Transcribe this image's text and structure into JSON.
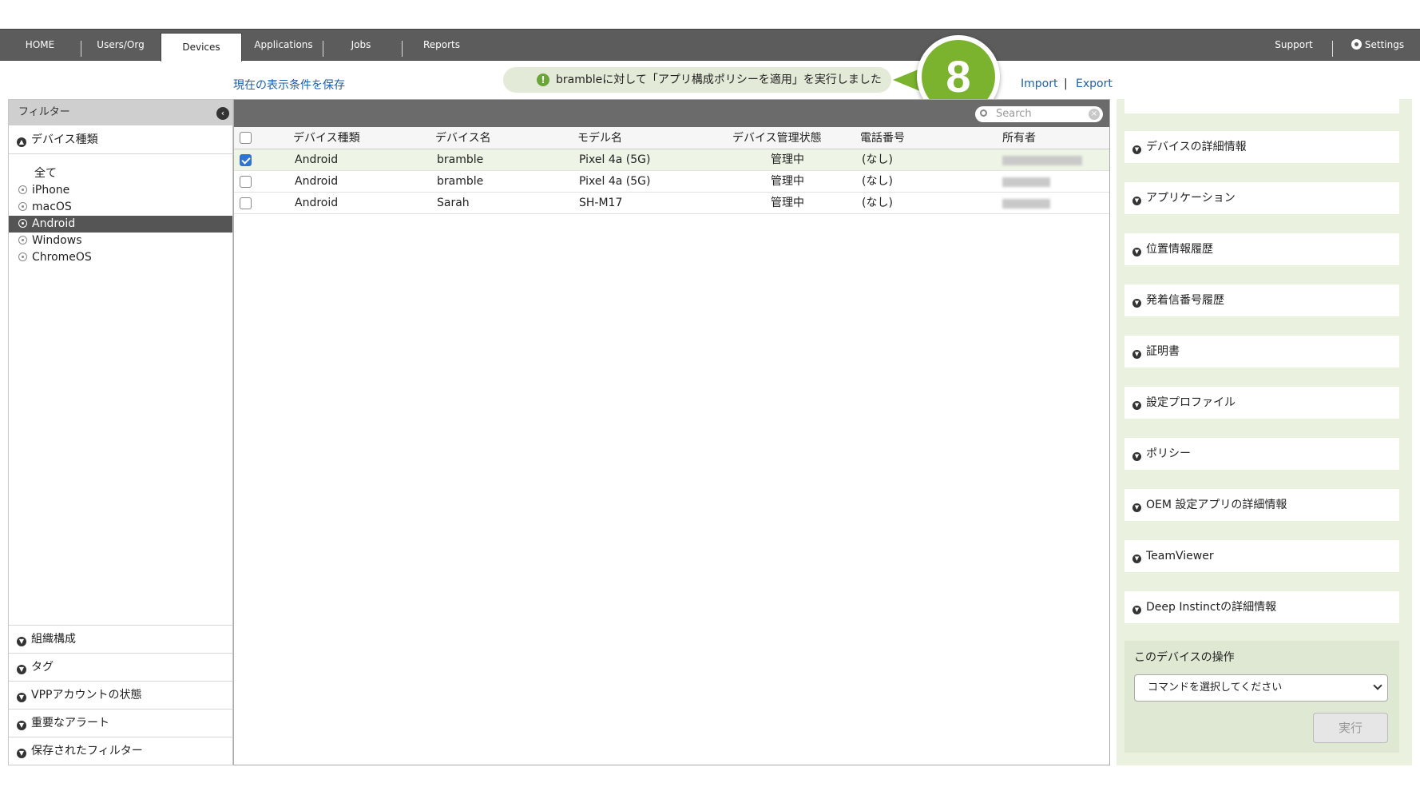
{
  "nav": {
    "tabs": [
      "HOME",
      "Users/Org",
      "Devices",
      "Applications",
      "Jobs",
      "Reports"
    ],
    "active_tab": "Devices",
    "support": "Support",
    "settings": "Settings"
  },
  "links": {
    "save_view": "現在の表示条件を保存",
    "import": "Import",
    "separator": "|",
    "export": "Export"
  },
  "toast": {
    "message": "brambleに対して「アプリ構成ポリシーを適用」を実行しました"
  },
  "step_badge": "8",
  "left": {
    "filter_title": "フィルター",
    "device_type_section": "デバイス種類",
    "all_label": "全て",
    "options": [
      "iPhone",
      "macOS",
      "Android",
      "Windows",
      "ChromeOS"
    ],
    "selected_option": "Android",
    "bottom_sections": [
      "組織構成",
      "タグ",
      "VPPアカウントの状態",
      "重要なアラート",
      "保存されたフィルター"
    ]
  },
  "table": {
    "search_placeholder": "Search",
    "columns": [
      "デバイス種類",
      "デバイス名",
      "モデル名",
      "デバイス管理状態",
      "電話番号",
      "所有者"
    ],
    "rows": [
      {
        "checked": true,
        "type": "Android",
        "name": "bramble",
        "model": "Pixel 4a (5G)",
        "status": "管理中",
        "phone": "(なし)"
      },
      {
        "checked": false,
        "type": "Android",
        "name": "bramble",
        "model": "Pixel 4a (5G)",
        "status": "管理中",
        "phone": "(なし)"
      },
      {
        "checked": false,
        "type": "Android",
        "name": "Sarah",
        "model": "SH-M17",
        "status": "管理中",
        "phone": "(なし)"
      }
    ]
  },
  "right": {
    "cards": [
      "デバイスの詳細情報",
      "アプリケーション",
      "位置情報履歴",
      "発着信番号履歴",
      "証明書",
      "設定プロファイル",
      "ポリシー",
      "OEM 設定アプリの詳細情報",
      "TeamViewer",
      "Deep Instinctの詳細情報"
    ],
    "ops_title": "このデバイスの操作",
    "command_select": "コマンドを選択してください",
    "run_button": "実行"
  },
  "colors": {
    "accent_green": "#7bb32e",
    "nav_bg": "#5c5c5c",
    "link_blue": "#1f5fa8",
    "selected_row": "#eef5e6"
  }
}
